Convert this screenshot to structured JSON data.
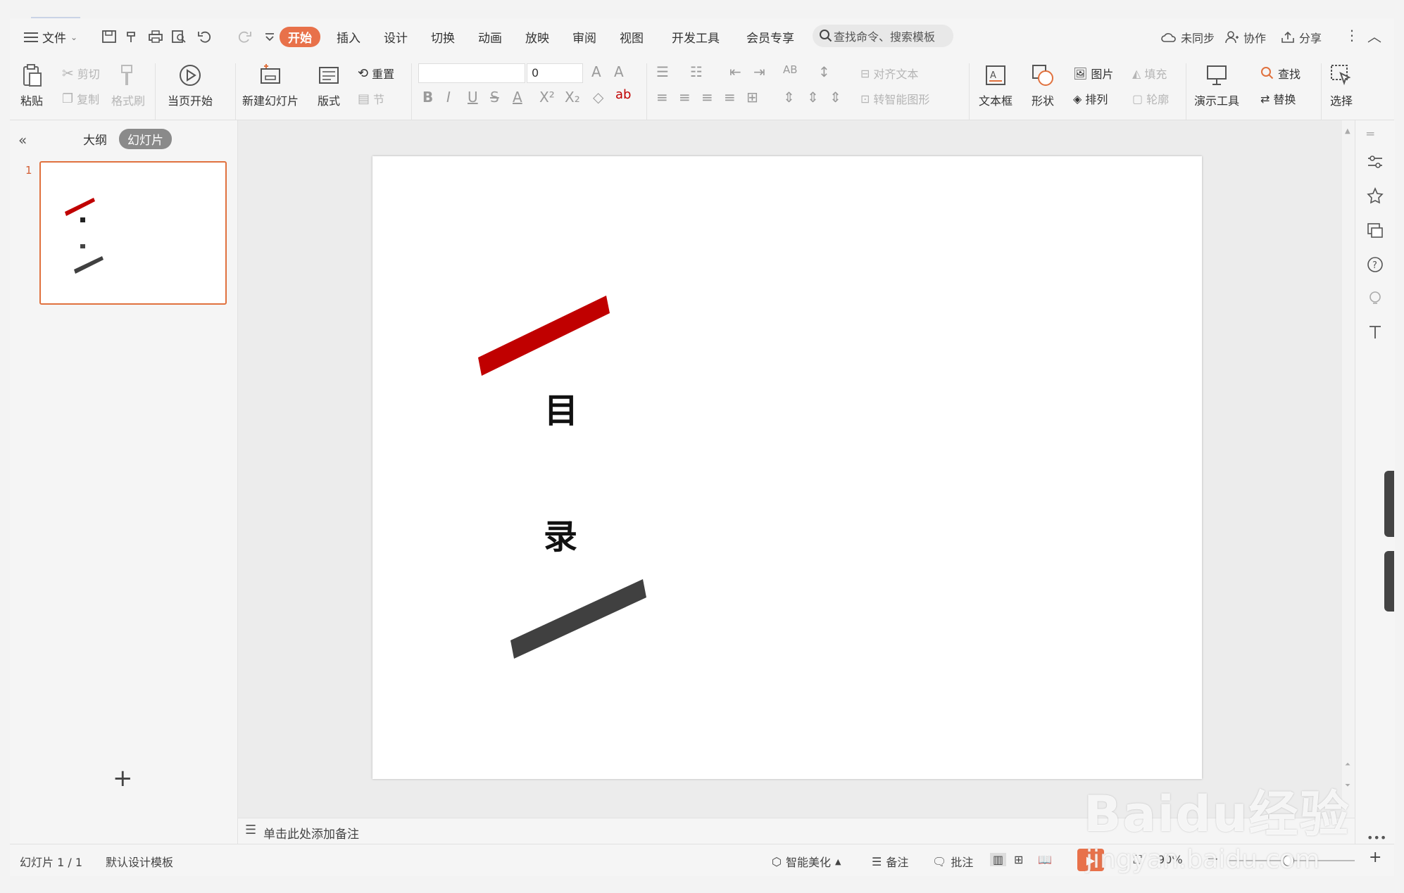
{
  "menu": {
    "file_label": "文件"
  },
  "tabs": [
    "开始",
    "插入",
    "设计",
    "切换",
    "动画",
    "放映",
    "审阅",
    "视图",
    "开发工具",
    "会员专享"
  ],
  "search": {
    "placeholder": "查找命令、搜索模板"
  },
  "header_right": {
    "sync": "未同步",
    "collab": "协作",
    "share": "分享"
  },
  "ribbon": {
    "paste": "粘贴",
    "cut": "剪切",
    "copy": "复制",
    "format_painter": "格式刷",
    "play_current": "当页开始",
    "new_slide": "新建幻灯片",
    "layout": "版式",
    "reset": "重置",
    "section": "节",
    "font_size": "0",
    "align_text": "对齐文本",
    "smartart": "转智能图形",
    "textbox": "文本框",
    "shape": "形状",
    "picture": "图片",
    "arrange": "排列",
    "fill": "填充",
    "outline": "轮廓",
    "presenter": "演示工具",
    "find": "查找",
    "replace": "替换",
    "select": "选择"
  },
  "panel": {
    "outline_tab": "大纲",
    "slides_tab": "幻灯片",
    "slide_number": "1"
  },
  "slide": {
    "char1": "目",
    "char2": "录",
    "accent_color": "#c00000",
    "dark_color": "#404040"
  },
  "notes": {
    "placeholder": "单击此处添加备注"
  },
  "status": {
    "slide_counter": "幻灯片 1 / 1",
    "template": "默认设计模板",
    "beautify": "智能美化",
    "notes": "备注",
    "comments": "批注",
    "zoom": "90%"
  },
  "watermark": {
    "brand": "Baidu经验",
    "url": "jingyan.baidu.com"
  }
}
